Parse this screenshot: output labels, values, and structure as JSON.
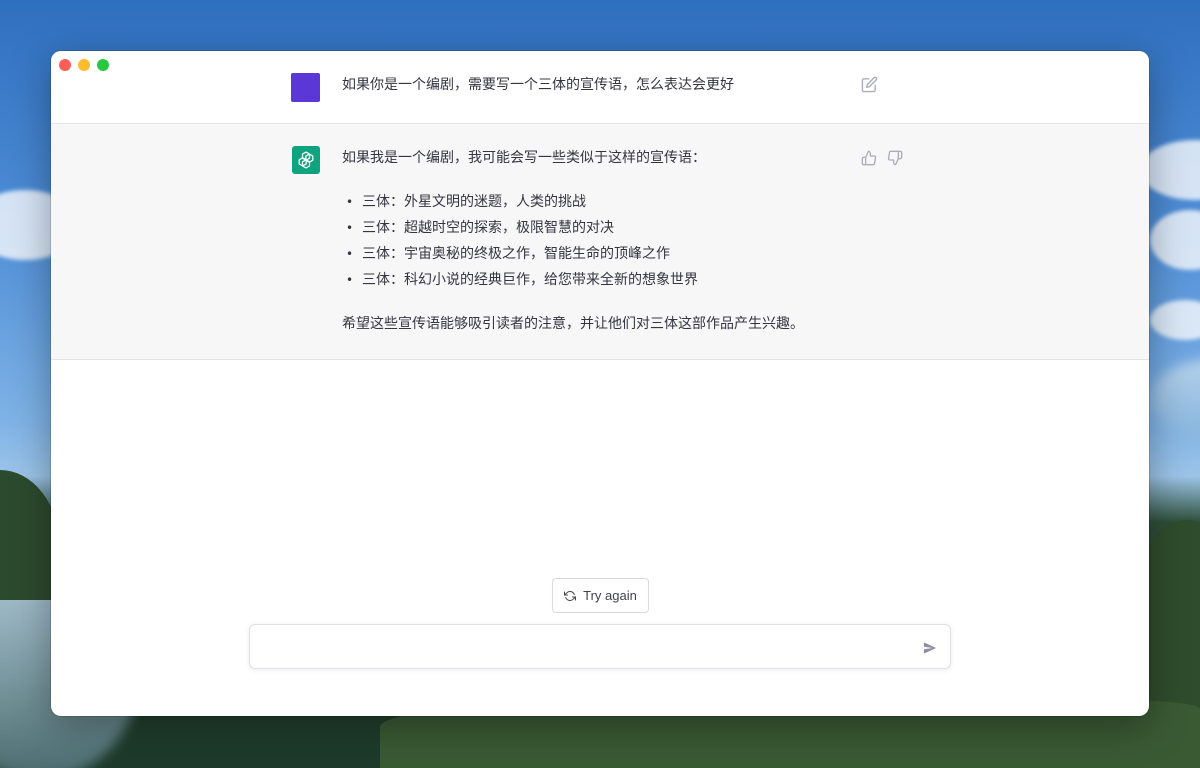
{
  "window": {
    "traffic_lights": [
      "close",
      "minimize",
      "zoom"
    ]
  },
  "conversation": {
    "user_message": "如果你是一个编剧，需要写一个三体的宣传语，怎么表达会更好",
    "assistant": {
      "intro": "如果我是一个编剧，我可能会写一些类似于这样的宣传语：",
      "bullet_glyph": "•",
      "items": [
        "三体：外星文明的迷题，人类的挑战",
        "三体：超越时空的探索，极限智慧的对决",
        "三体：宇宙奥秘的终极之作，智能生命的顶峰之作",
        "三体：科幻小说的经典巨作，给您带来全新的想象世界"
      ],
      "outro": "希望这些宣传语能够吸引读者的注意，并让他们对三体这部作品产生兴趣。"
    }
  },
  "actions": {
    "try_again_label": "Try again"
  },
  "composer": {
    "value": "",
    "placeholder": ""
  },
  "icons": {
    "edit": "edit-icon",
    "thumbs_up": "thumbs-up-icon",
    "thumbs_down": "thumbs-down-icon",
    "refresh": "refresh-icon",
    "send": "send-icon",
    "assistant_logo": "assistant-logo-icon"
  },
  "colors": {
    "user_avatar": "#5b37d6",
    "assistant_avatar": "#10a37f",
    "assistant_row_bg": "#f7f7f8",
    "text": "#343541"
  }
}
